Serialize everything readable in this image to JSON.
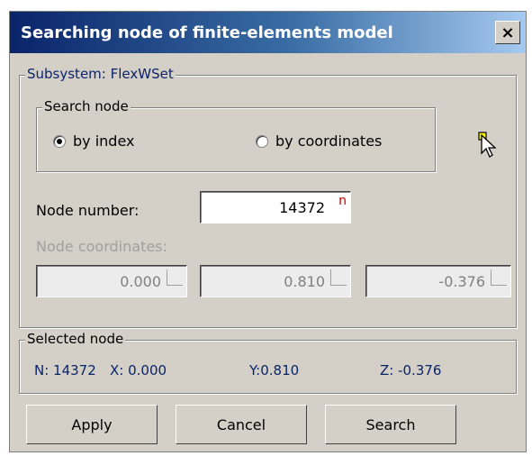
{
  "window": {
    "title": "Searching node of finite-elements model",
    "close_label": "×"
  },
  "subsystem_group": {
    "legend": "Subsystem: FlexWSet"
  },
  "search_group": {
    "legend": "Search node",
    "options": [
      {
        "label": "by index",
        "checked": true
      },
      {
        "label": "by coordinates",
        "checked": false
      }
    ]
  },
  "node_number": {
    "label": "Node number:",
    "value": "14372",
    "unit_glyph": "n"
  },
  "node_coordinates": {
    "label": "Node coordinates:",
    "values": [
      "0.000",
      "0.810",
      "-0.376"
    ]
  },
  "selected_group": {
    "legend": "Selected node",
    "n": "N: 14372",
    "x": "X: 0.000",
    "y": "Y:0.810",
    "z": "Z: -0.376"
  },
  "buttons": {
    "apply": "Apply",
    "cancel": "Cancel",
    "search": "Search"
  },
  "icons": {
    "pointer": "pointer-cursor-icon"
  }
}
